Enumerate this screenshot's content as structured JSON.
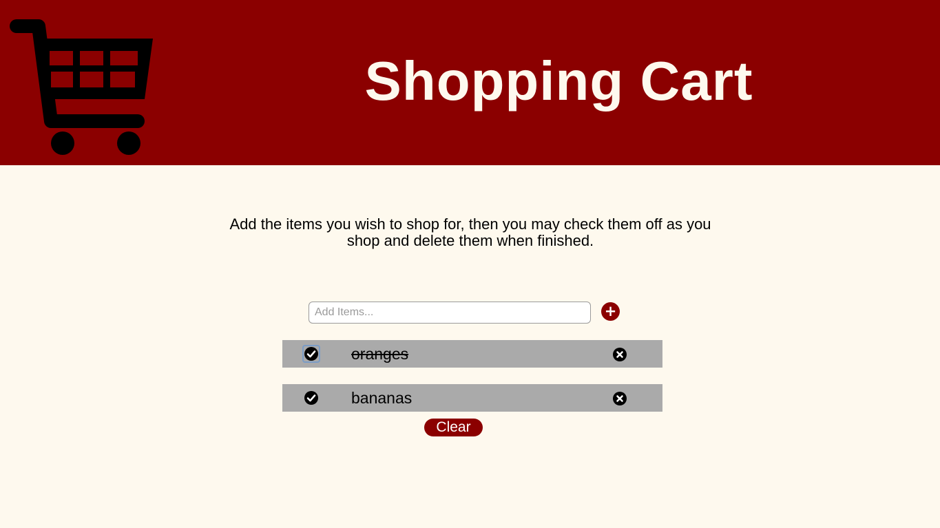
{
  "header": {
    "title": "Shopping Cart",
    "background_color": "#8b0000",
    "title_color": "#fef9ee",
    "logo_icon": "shopping-cart-icon"
  },
  "intro": {
    "text": "Add the items you wish to shop for, then you may check them off as you shop and delete them when finished."
  },
  "add_form": {
    "input_value": "",
    "input_placeholder": "Add Items...",
    "add_button_label": "+"
  },
  "items": [
    {
      "label": "oranges",
      "checked": true,
      "check_icon": "check-circle-icon",
      "delete_icon": "times-circle-icon"
    },
    {
      "label": "bananas",
      "checked": false,
      "check_icon": "check-circle-icon",
      "delete_icon": "times-circle-icon"
    }
  ],
  "clear_button_label": "Clear",
  "colors": {
    "page_background": "#fef9ee",
    "accent": "#8b0000",
    "item_background": "#aaaaaa"
  }
}
